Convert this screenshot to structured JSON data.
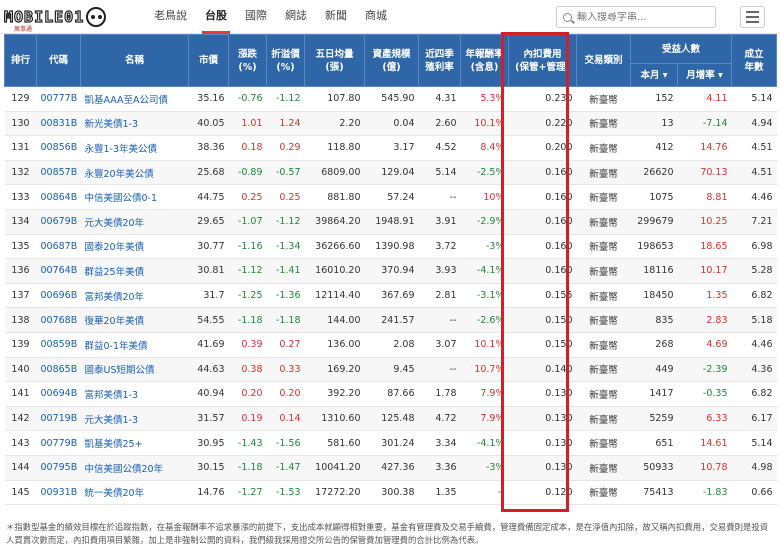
{
  "header": {
    "logo_text": "MOBILE01",
    "logo_sub": "萬事通",
    "nav": [
      "老鳥說",
      "台股",
      "國際",
      "網誌",
      "新聞",
      "商城"
    ],
    "active_nav": 1,
    "search_placeholder": "輸入搜尋字串..."
  },
  "table": {
    "headers": {
      "rank": "排行",
      "code": "代碼",
      "name": "名稱",
      "price": "市價",
      "change": "漲跌\n(%)",
      "premium": "折溢價\n(%)",
      "volume": "五日均量\n(張)",
      "aum": "資產規模\n(億)",
      "yield": "近四季\n殖利率",
      "annual_return": "年報酬率\n(含息)",
      "fee": "內扣費用\n(保管+管理)",
      "category": "交易類別",
      "beneficiaries": "受益人數",
      "ben_month": "本月",
      "ben_month_rate": "月增率",
      "age": "成立\n年數"
    },
    "rows": [
      {
        "rank": "129",
        "code": "00777B",
        "name": "凱基AAA至A公司債",
        "price": "35.16",
        "change": "-0.76",
        "premium": "-1.12",
        "volume": "107.80",
        "aum": "545.90",
        "yield": "4.31",
        "annual_return": "5.3%",
        "fee": "0.230",
        "category": "新臺幣",
        "ben": "152",
        "ben_rate": "4.11",
        "age": "5.14"
      },
      {
        "rank": "130",
        "code": "00831B",
        "name": "新光美債1-3",
        "price": "40.05",
        "change": "1.01",
        "premium": "1.24",
        "volume": "2.20",
        "aum": "0.04",
        "yield": "2.60",
        "annual_return": "10.1%",
        "fee": "0.220",
        "category": "新臺幣",
        "ben": "13",
        "ben_rate": "-7.14",
        "age": "4.94"
      },
      {
        "rank": "131",
        "code": "00856B",
        "name": "永豐1-3年美公債",
        "price": "38.36",
        "change": "0.18",
        "premium": "0.29",
        "volume": "118.80",
        "aum": "3.17",
        "yield": "4.52",
        "annual_return": "8.4%",
        "fee": "0.200",
        "category": "新臺幣",
        "ben": "412",
        "ben_rate": "14.76",
        "age": "4.51"
      },
      {
        "rank": "132",
        "code": "00857B",
        "name": "永豐20年美公債",
        "price": "25.68",
        "change": "-0.89",
        "premium": "-0.57",
        "volume": "6809.00",
        "aum": "129.04",
        "yield": "5.14",
        "annual_return": "-2.5%",
        "fee": "0.160",
        "category": "新臺幣",
        "ben": "26620",
        "ben_rate": "70.13",
        "age": "4.51"
      },
      {
        "rank": "133",
        "code": "00864B",
        "name": "中信美國公債0-1",
        "price": "44.75",
        "change": "0.25",
        "premium": "0.25",
        "volume": "881.80",
        "aum": "57.24",
        "yield": "--",
        "annual_return": "10%",
        "fee": "0.160",
        "category": "新臺幣",
        "ben": "1075",
        "ben_rate": "8.81",
        "age": "4.46"
      },
      {
        "rank": "134",
        "code": "00679B",
        "name": "元大美債20年",
        "price": "29.65",
        "change": "-1.07",
        "premium": "-1.12",
        "volume": "39864.20",
        "aum": "1948.91",
        "yield": "3.91",
        "annual_return": "-2.9%",
        "fee": "0.160",
        "category": "新臺幣",
        "ben": "299679",
        "ben_rate": "10.25",
        "age": "7.21"
      },
      {
        "rank": "135",
        "code": "00687B",
        "name": "國泰20年美債",
        "price": "30.77",
        "change": "-1.16",
        "premium": "-1.34",
        "volume": "36266.60",
        "aum": "1390.98",
        "yield": "3.72",
        "annual_return": "-3%",
        "fee": "0.160",
        "category": "新臺幣",
        "ben": "198653",
        "ben_rate": "18.65",
        "age": "6.98"
      },
      {
        "rank": "136",
        "code": "00764B",
        "name": "群益25年美債",
        "price": "30.81",
        "change": "-1.12",
        "premium": "-1.41",
        "volume": "16010.20",
        "aum": "370.94",
        "yield": "3.93",
        "annual_return": "-4.1%",
        "fee": "0.160",
        "category": "新臺幣",
        "ben": "18116",
        "ben_rate": "10.17",
        "age": "5.28"
      },
      {
        "rank": "137",
        "code": "00696B",
        "name": "富邦美債20年",
        "price": "31.7",
        "change": "-1.25",
        "premium": "-1.36",
        "volume": "12114.40",
        "aum": "367.69",
        "yield": "2.81",
        "annual_return": "-3.1%",
        "fee": "0.155",
        "category": "新臺幣",
        "ben": "18450",
        "ben_rate": "1.35",
        "age": "6.82"
      },
      {
        "rank": "138",
        "code": "00768B",
        "name": "復華20年美債",
        "price": "54.55",
        "change": "-1.18",
        "premium": "-1.18",
        "volume": "144.00",
        "aum": "241.57",
        "yield": "--",
        "annual_return": "-2.6%",
        "fee": "0.150",
        "category": "新臺幣",
        "ben": "835",
        "ben_rate": "2.83",
        "age": "5.18"
      },
      {
        "rank": "139",
        "code": "00859B",
        "name": "群益0-1年美債",
        "price": "41.69",
        "change": "0.39",
        "premium": "0.27",
        "volume": "136.00",
        "aum": "2.08",
        "yield": "3.07",
        "annual_return": "10.1%",
        "fee": "0.150",
        "category": "新臺幣",
        "ben": "268",
        "ben_rate": "4.69",
        "age": "4.46"
      },
      {
        "rank": "140",
        "code": "00865B",
        "name": "國泰US短期公債",
        "price": "44.63",
        "change": "0.38",
        "premium": "0.33",
        "volume": "169.20",
        "aum": "9.45",
        "yield": "--",
        "annual_return": "10.7%",
        "fee": "0.140",
        "category": "新臺幣",
        "ben": "449",
        "ben_rate": "-2.39",
        "age": "4.36"
      },
      {
        "rank": "141",
        "code": "00694B",
        "name": "富邦美債1-3",
        "price": "40.94",
        "change": "0.20",
        "premium": "0.20",
        "volume": "392.20",
        "aum": "87.66",
        "yield": "1.78",
        "annual_return": "7.9%",
        "fee": "0.130",
        "category": "新臺幣",
        "ben": "1417",
        "ben_rate": "-0.35",
        "age": "6.82"
      },
      {
        "rank": "142",
        "code": "00719B",
        "name": "元大美債1-3",
        "price": "31.57",
        "change": "0.19",
        "premium": "0.14",
        "volume": "1310.60",
        "aum": "125.48",
        "yield": "4.72",
        "annual_return": "7.9%",
        "fee": "0.130",
        "category": "新臺幣",
        "ben": "5259",
        "ben_rate": "6.33",
        "age": "6.17"
      },
      {
        "rank": "143",
        "code": "00779B",
        "name": "凱基美債25+",
        "price": "30.95",
        "change": "-1.43",
        "premium": "-1.56",
        "volume": "581.60",
        "aum": "301.24",
        "yield": "3.34",
        "annual_return": "-4.1%",
        "fee": "0.130",
        "category": "新臺幣",
        "ben": "651",
        "ben_rate": "14.61",
        "age": "5.14"
      },
      {
        "rank": "144",
        "code": "00795B",
        "name": "中信美國公債20年",
        "price": "30.15",
        "change": "-1.18",
        "premium": "-1.47",
        "volume": "10041.20",
        "aum": "427.36",
        "yield": "3.36",
        "annual_return": "-3%",
        "fee": "0.130",
        "category": "新臺幣",
        "ben": "50933",
        "ben_rate": "10.78",
        "age": "4.98"
      },
      {
        "rank": "145",
        "code": "00931B",
        "name": "統一美債20年",
        "price": "14.76",
        "change": "-1.27",
        "premium": "-1.53",
        "volume": "17272.20",
        "aum": "300.38",
        "yield": "1.35",
        "annual_return": "--",
        "fee": "0.120",
        "category": "新臺幣",
        "ben": "75413",
        "ben_rate": "-1.83",
        "age": "0.66"
      }
    ]
  },
  "footnote": "＊指數型基金的績效目標在於追蹤指數，在基金報酬率不追求暴漲的前提下，支出成本就顯得相對重要，基金有管理費及交易手續費，管理費備固定成本，是在淨值內扣除，故又稱內扣費用，交易費則是投資人買賣次數而定，內扣費用項目繁雜，加上是非強制公開的資料，我們級我採用證交所公告的保管費加管理費的合計比例為代表。",
  "colors": {
    "header_bg": "#2e66a8",
    "up": "#d9302f",
    "down": "#1e8a3a",
    "highlight": "#d21f2a",
    "link": "#1a5fb4"
  }
}
